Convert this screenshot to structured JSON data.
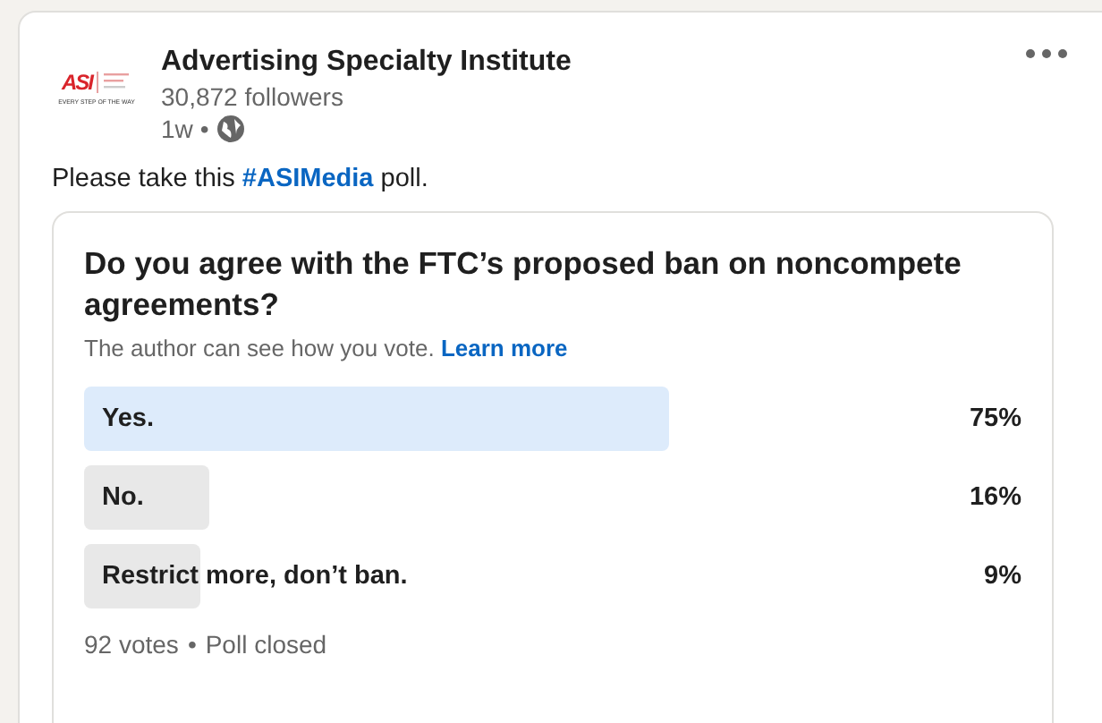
{
  "post": {
    "author": "Advertising Specialty Institute",
    "logo": {
      "mark": "ASI",
      "tagline": "EVERY STEP OF THE WAY"
    },
    "followers": "30,872 followers",
    "time": "1w",
    "separator": "•",
    "text_before": "Please take this ",
    "hashtag": "#ASIMedia",
    "text_after": " poll."
  },
  "poll": {
    "question": "Do you agree with the FTC’s proposed ban on noncompete agreements?",
    "note": "The author can see how you vote.",
    "learn_more": "Learn more",
    "options": [
      {
        "label": "Yes.",
        "percent": "75%",
        "selected": true
      },
      {
        "label": "No.",
        "percent": "16%",
        "selected": false
      },
      {
        "label": "Restrict more, don’t ban.",
        "percent": "9%",
        "selected": false
      }
    ],
    "votes": "92 votes",
    "separator": "•",
    "status": "Poll closed"
  }
}
